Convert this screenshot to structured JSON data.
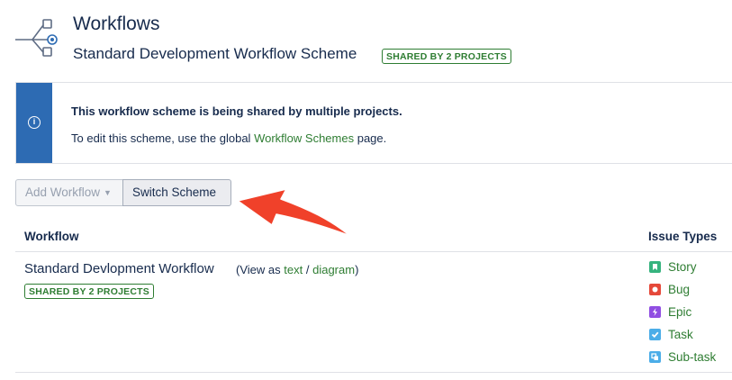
{
  "header": {
    "title": "Workflows",
    "scheme_name": "Standard Development Workflow Scheme",
    "shared_badge": "SHARED BY 2 PROJECTS"
  },
  "info": {
    "title": "This workflow scheme is being shared by multiple projects.",
    "text_before": "To edit this scheme, use the global",
    "link": "Workflow Schemes",
    "text_after": "page."
  },
  "toolbar": {
    "add_workflow": "Add Workflow",
    "switch_scheme": "Switch Scheme"
  },
  "table": {
    "col_workflow": "Workflow",
    "col_issue_types": "Issue Types",
    "row": {
      "name": "Standard Devlopment Workflow",
      "view_prefix": "(View as",
      "view_text": "text",
      "view_sep": "/",
      "view_diagram": "diagram",
      "view_suffix": ")",
      "badge": "SHARED BY 2 PROJECTS"
    },
    "issue_types": [
      "Story",
      "Bug",
      "Epic",
      "Task",
      "Sub-task"
    ]
  },
  "colors": {
    "accent_green": "#2e7d32",
    "info_blue": "#2d6bb3",
    "annotation_arrow": "#f0412a",
    "story": "#36b37e",
    "bug": "#e5493a",
    "epic": "#904ee2",
    "task": "#4bade8"
  },
  "icons": {
    "header": "workflow-icon",
    "info": "info-icon",
    "story": "story-icon",
    "bug": "bug-icon",
    "epic": "epic-icon",
    "task": "task-icon",
    "subtask": "subtask-icon"
  }
}
